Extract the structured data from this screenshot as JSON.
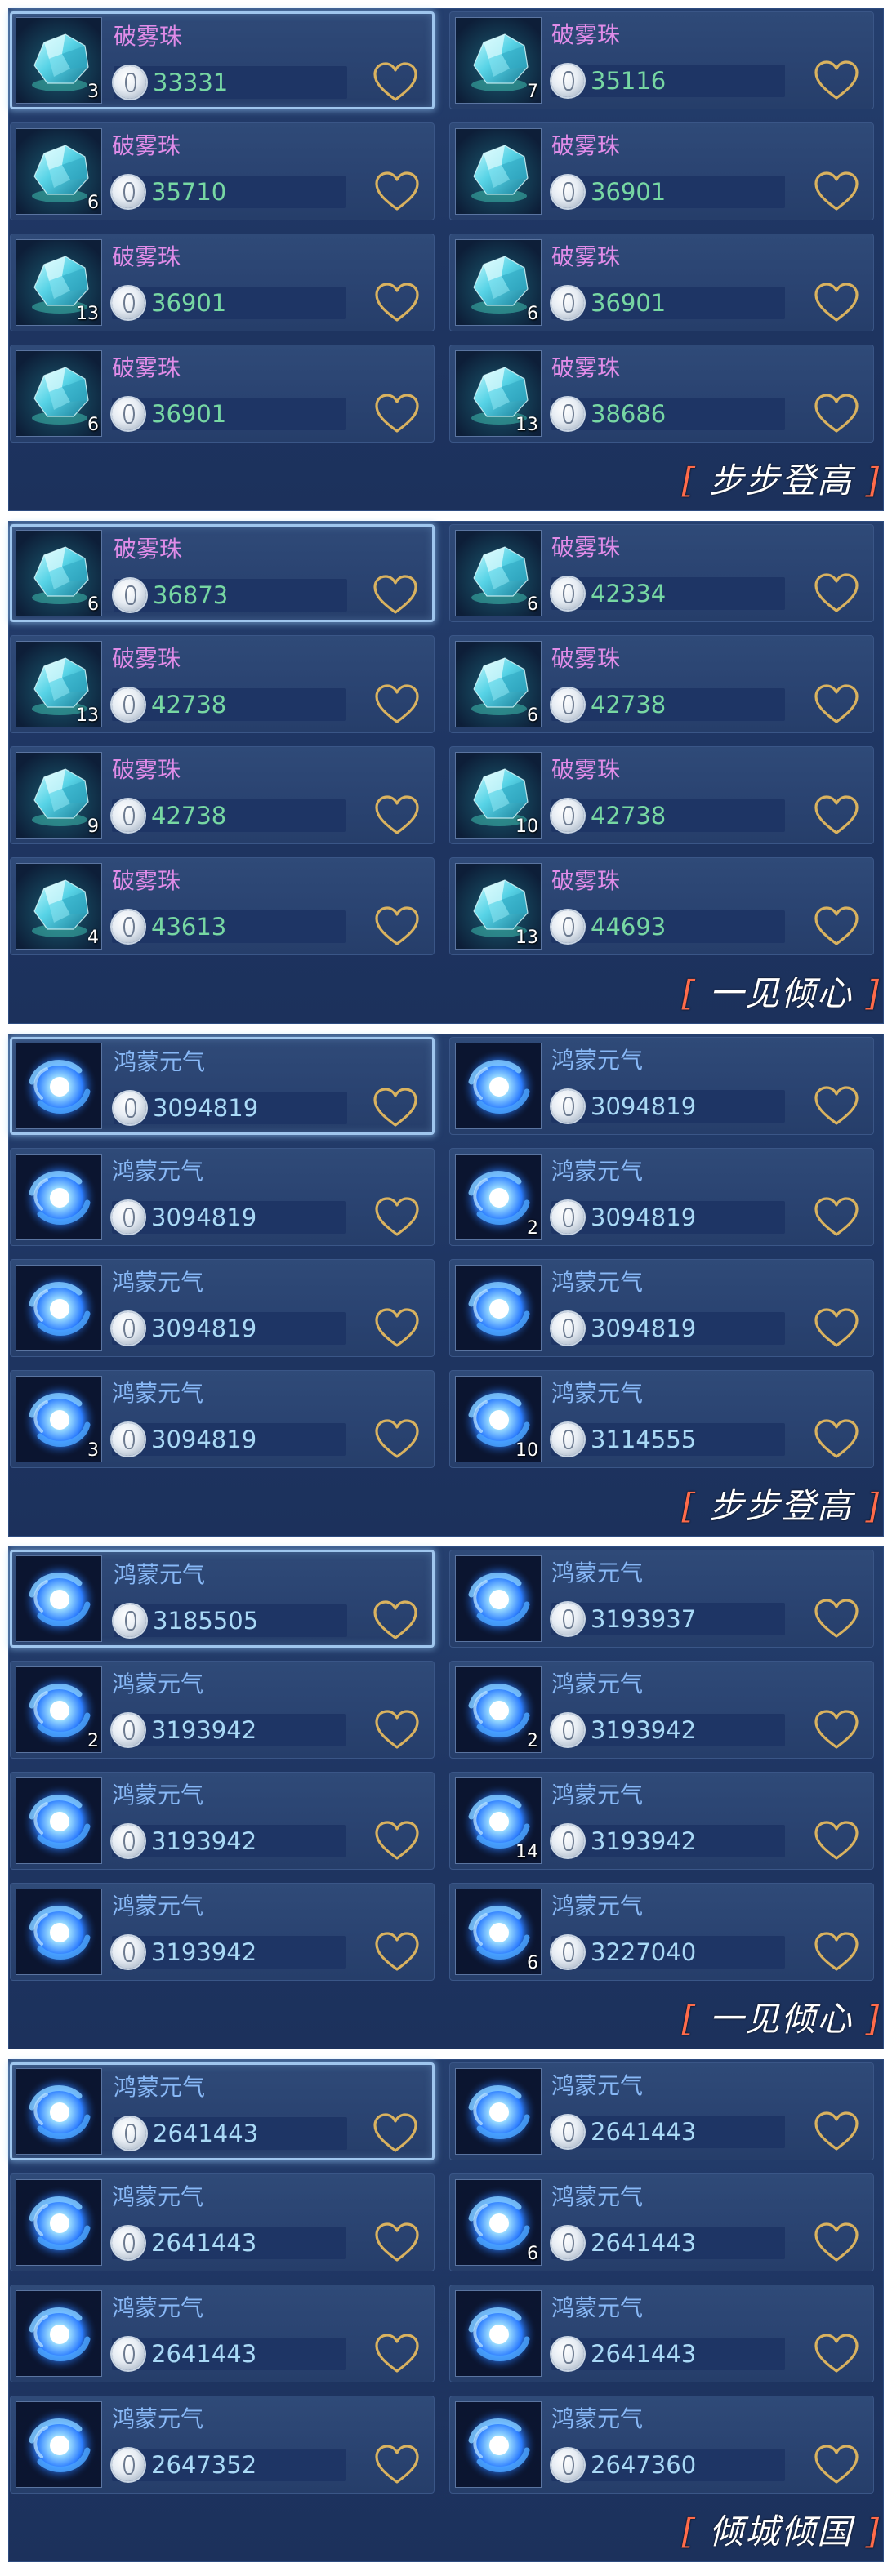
{
  "panels": [
    {
      "tag": "步步登高",
      "items": [
        {
          "name": "破雾珠",
          "count": "3",
          "price": "33331",
          "icon": "crystal-icon"
        },
        {
          "name": "破雾珠",
          "count": "7",
          "price": "35116",
          "icon": "crystal-icon"
        },
        {
          "name": "破雾珠",
          "count": "6",
          "price": "35710",
          "icon": "crystal-icon"
        },
        {
          "name": "破雾珠",
          "count": "",
          "price": "36901",
          "icon": "crystal-icon"
        },
        {
          "name": "破雾珠",
          "count": "13",
          "price": "36901",
          "icon": "crystal-icon"
        },
        {
          "name": "破雾珠",
          "count": "6",
          "price": "36901",
          "icon": "crystal-icon"
        },
        {
          "name": "破雾珠",
          "count": "6",
          "price": "36901",
          "icon": "crystal-icon"
        },
        {
          "name": "破雾珠",
          "count": "13",
          "price": "38686",
          "icon": "crystal-icon"
        }
      ]
    },
    {
      "tag": "一见倾心",
      "items": [
        {
          "name": "破雾珠",
          "count": "6",
          "price": "36873",
          "icon": "crystal-icon"
        },
        {
          "name": "破雾珠",
          "count": "6",
          "price": "42334",
          "icon": "crystal-icon"
        },
        {
          "name": "破雾珠",
          "count": "13",
          "price": "42738",
          "icon": "crystal-icon"
        },
        {
          "name": "破雾珠",
          "count": "6",
          "price": "42738",
          "icon": "crystal-icon"
        },
        {
          "name": "破雾珠",
          "count": "9",
          "price": "42738",
          "icon": "crystal-icon"
        },
        {
          "name": "破雾珠",
          "count": "10",
          "price": "42738",
          "icon": "crystal-icon"
        },
        {
          "name": "破雾珠",
          "count": "4",
          "price": "43613",
          "icon": "crystal-icon"
        },
        {
          "name": "破雾珠",
          "count": "13",
          "price": "44693",
          "icon": "crystal-icon"
        }
      ]
    },
    {
      "tag": "步步登高",
      "items": [
        {
          "name": "鸿蒙元气",
          "count": "",
          "price": "3094819",
          "icon": "swirl-icon"
        },
        {
          "name": "鸿蒙元气",
          "count": "",
          "price": "3094819",
          "icon": "swirl-icon"
        },
        {
          "name": "鸿蒙元气",
          "count": "",
          "price": "3094819",
          "icon": "swirl-icon"
        },
        {
          "name": "鸿蒙元气",
          "count": "2",
          "price": "3094819",
          "icon": "swirl-icon"
        },
        {
          "name": "鸿蒙元气",
          "count": "",
          "price": "3094819",
          "icon": "swirl-icon"
        },
        {
          "name": "鸿蒙元气",
          "count": "",
          "price": "3094819",
          "icon": "swirl-icon"
        },
        {
          "name": "鸿蒙元气",
          "count": "3",
          "price": "3094819",
          "icon": "swirl-icon"
        },
        {
          "name": "鸿蒙元气",
          "count": "10",
          "price": "3114555",
          "icon": "swirl-icon"
        }
      ]
    },
    {
      "tag": "一见倾心",
      "items": [
        {
          "name": "鸿蒙元气",
          "count": "",
          "price": "3185505",
          "icon": "swirl-icon"
        },
        {
          "name": "鸿蒙元气",
          "count": "",
          "price": "3193937",
          "icon": "swirl-icon"
        },
        {
          "name": "鸿蒙元气",
          "count": "2",
          "price": "3193942",
          "icon": "swirl-icon"
        },
        {
          "name": "鸿蒙元气",
          "count": "2",
          "price": "3193942",
          "icon": "swirl-icon"
        },
        {
          "name": "鸿蒙元气",
          "count": "",
          "price": "3193942",
          "icon": "swirl-icon"
        },
        {
          "name": "鸿蒙元气",
          "count": "14",
          "price": "3193942",
          "icon": "swirl-icon"
        },
        {
          "name": "鸿蒙元气",
          "count": "",
          "price": "3193942",
          "icon": "swirl-icon"
        },
        {
          "name": "鸿蒙元气",
          "count": "6",
          "price": "3227040",
          "icon": "swirl-icon"
        }
      ]
    },
    {
      "tag": "倾城倾国",
      "items": [
        {
          "name": "鸿蒙元气",
          "count": "",
          "price": "2641443",
          "icon": "swirl-icon"
        },
        {
          "name": "鸿蒙元气",
          "count": "",
          "price": "2641443",
          "icon": "swirl-icon"
        },
        {
          "name": "鸿蒙元气",
          "count": "",
          "price": "2641443",
          "icon": "swirl-icon"
        },
        {
          "name": "鸿蒙元气",
          "count": "6",
          "price": "2641443",
          "icon": "swirl-icon"
        },
        {
          "name": "鸿蒙元气",
          "count": "",
          "price": "2641443",
          "icon": "swirl-icon"
        },
        {
          "name": "鸿蒙元气",
          "count": "",
          "price": "2641443",
          "icon": "swirl-icon"
        },
        {
          "name": "鸿蒙元气",
          "count": "",
          "price": "2647352",
          "icon": "swirl-icon"
        },
        {
          "name": "鸿蒙元气",
          "count": "",
          "price": "2647360",
          "icon": "swirl-icon"
        }
      ]
    }
  ],
  "colors": {
    "crystal_name": "#e08ce8",
    "swirl_name": "#88b8f6",
    "crystal_price": "#77d7a3",
    "swirl_price": "#a9d9f6",
    "heart": "#d9b25f",
    "tag_bracket": "#ff6b4a"
  }
}
